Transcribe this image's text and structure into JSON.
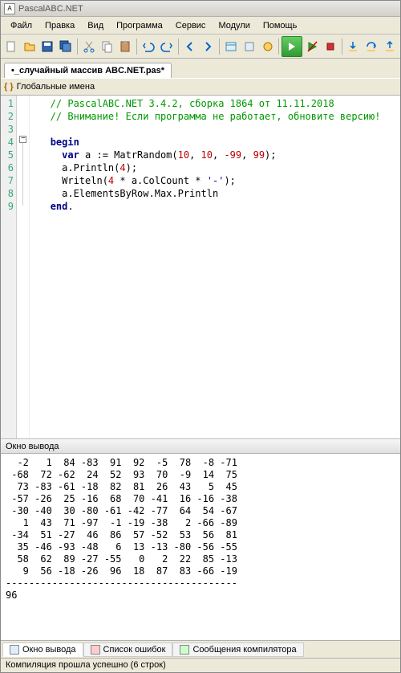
{
  "window": {
    "title": "PascalABC.NET"
  },
  "menu": {
    "file": "Файл",
    "edit": "Правка",
    "view": "Вид",
    "program": "Программа",
    "service": "Сервис",
    "modules": "Модули",
    "help": "Помощь"
  },
  "tab": {
    "name": "•_случайный массив ABC.NET.pas*"
  },
  "nav": {
    "scope_icon": "{ }",
    "scope": "Глобальные имена"
  },
  "code": {
    "lines": [
      {
        "n": "1",
        "segs": [
          {
            "t": "   // PascalABC.NET 3.4.2, сборка 1864 от 11.11.2018",
            "c": "cmt"
          }
        ]
      },
      {
        "n": "2",
        "segs": [
          {
            "t": "   // Внимание! Если программа не работает, обновите версию!",
            "c": "cmt"
          }
        ]
      },
      {
        "n": "3",
        "segs": [
          {
            "t": "   ",
            "c": ""
          }
        ]
      },
      {
        "n": "4",
        "segs": [
          {
            "t": "   ",
            "c": ""
          },
          {
            "t": "begin",
            "c": "kw"
          }
        ]
      },
      {
        "n": "5",
        "segs": [
          {
            "t": "     ",
            "c": ""
          },
          {
            "t": "var",
            "c": "kw"
          },
          {
            "t": " a := MatrRandom(",
            "c": ""
          },
          {
            "t": "10",
            "c": "num"
          },
          {
            "t": ", ",
            "c": ""
          },
          {
            "t": "10",
            "c": "num"
          },
          {
            "t": ", ",
            "c": ""
          },
          {
            "t": "-99",
            "c": "num"
          },
          {
            "t": ", ",
            "c": ""
          },
          {
            "t": "99",
            "c": "num"
          },
          {
            "t": ");",
            "c": ""
          }
        ]
      },
      {
        "n": "6",
        "segs": [
          {
            "t": "     a.Println(",
            "c": ""
          },
          {
            "t": "4",
            "c": "num"
          },
          {
            "t": ");",
            "c": ""
          }
        ]
      },
      {
        "n": "7",
        "segs": [
          {
            "t": "     Writeln(",
            "c": ""
          },
          {
            "t": "4",
            "c": "num"
          },
          {
            "t": " * a.ColCount * ",
            "c": ""
          },
          {
            "t": "'-'",
            "c": "str"
          },
          {
            "t": ");",
            "c": ""
          }
        ]
      },
      {
        "n": "8",
        "segs": [
          {
            "t": "     a.ElementsByRow.Max.Println",
            "c": ""
          }
        ]
      },
      {
        "n": "9",
        "segs": [
          {
            "t": "   ",
            "c": ""
          },
          {
            "t": "end",
            "c": "kw"
          },
          {
            "t": ".",
            "c": ""
          }
        ]
      }
    ]
  },
  "output": {
    "title": "Окно вывода",
    "rows": [
      "  -2   1  84 -83  91  92  -5  78  -8 -71",
      " -68  72 -62  24  52  93  70  -9  14  75",
      "  73 -83 -61 -18  82  81  26  43   5  45",
      " -57 -26  25 -16  68  70 -41  16 -16 -38",
      " -30 -40  30 -80 -61 -42 -77  64  54 -67",
      "   1  43  71 -97  -1 -19 -38   2 -66 -89",
      " -34  51 -27  46  86  57 -52  53  56  81",
      "  35 -46 -93 -48   6  13 -13 -80 -56 -55",
      "  58  62  89 -27 -55   0   2  22  85 -13",
      "   9  56 -18 -26  96  18  87  83 -66 -19",
      "----------------------------------------",
      "96"
    ]
  },
  "bottom_tabs": {
    "output": "Окно вывода",
    "errors": "Список ошибок",
    "compiler": "Сообщения компилятора"
  },
  "status": {
    "text": "Компиляция прошла успешно (6 строк)"
  }
}
